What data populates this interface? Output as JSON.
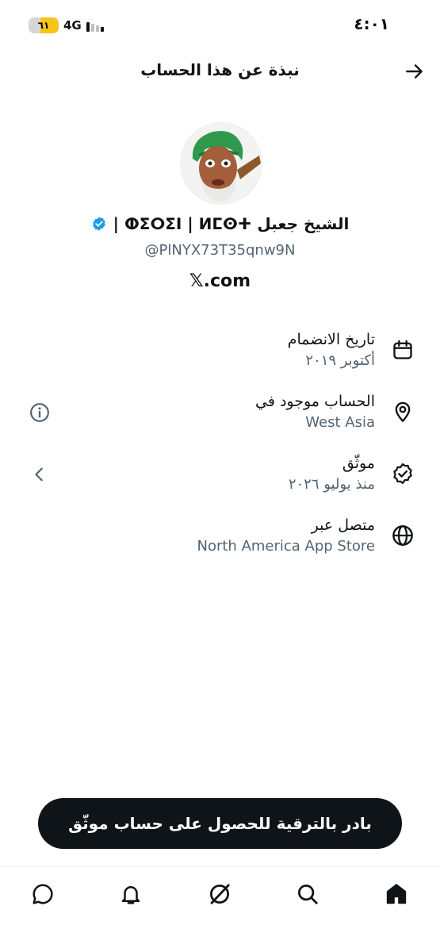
{
  "status_bar": {
    "time": "٤:٠١",
    "battery": "٦١",
    "battery_level": 0.61,
    "network": "4G"
  },
  "header": {
    "title": "نبذة عن هذا الحساب",
    "back_icon": "arrow-right-icon"
  },
  "profile": {
    "name": "الشيخ جعبل ⵀⵉⵔⵉⵏ | ⵍⵎⵙⵜ |",
    "handle": "@PlNYX73T35qnw9N",
    "site": "𝕏.com",
    "verified_color": "#1d9bf0"
  },
  "info": [
    {
      "icon": "calendar-icon",
      "title": "تاريخ الانضمام",
      "value": "أكتوبر ٢٠١٩"
    },
    {
      "icon": "location-pin-icon",
      "title": "الحساب موجود في",
      "value": "West Asia"
    },
    {
      "icon": "verified-check-icon",
      "title": "موثّق",
      "value": "منذ يوليو ٢٠٢٦"
    },
    {
      "icon": "globe-icon",
      "title": "متصل عبر",
      "value": "North America App Store"
    }
  ],
  "upgrade": {
    "label": "بادر بالترقية للحصول على حساب موثّق"
  },
  "bottom_nav": [
    "home-icon",
    "search-icon",
    "grok-icon",
    "notifications-icon",
    "messages-icon"
  ]
}
